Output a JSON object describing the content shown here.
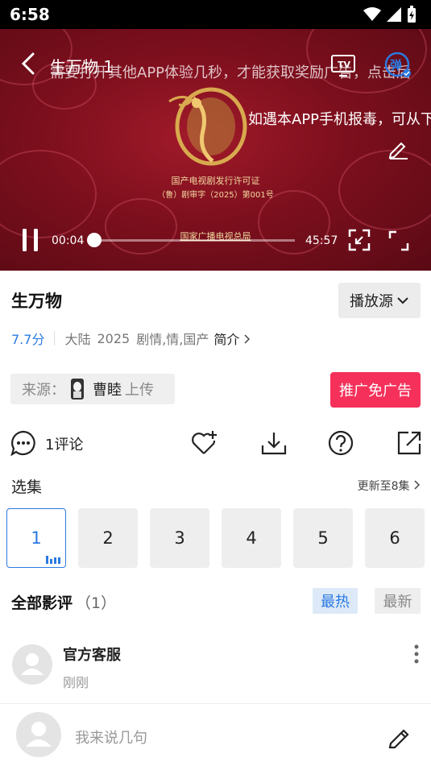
{
  "status_bar": {
    "time": "6:58"
  },
  "player": {
    "title": "生万物 1",
    "marquee_top": "需要打开其他APP体验几秒，才能获取奖励广告，点击后",
    "marquee_mid": "如遇本APP手机报毒，可从下",
    "license_line1": "国产电视剧发行许可证",
    "license_line2": "（鲁）剧审字（2025）第001号",
    "license_line3": "国家广播电视总局",
    "current_time": "00:04",
    "total_time": "45:57",
    "progress": 0.0015
  },
  "show": {
    "title": "生万物",
    "source_button": "播放源",
    "rating": "7.7分",
    "region": "大陆",
    "year": "2025",
    "genres": "剧情,情,国产",
    "intro": "简介"
  },
  "uploader": {
    "prefix": "来源：",
    "name": "曹睦",
    "suffix": "上传",
    "promo_button": "推广免广告"
  },
  "actions": {
    "comment_count": "1评论"
  },
  "episodes": {
    "heading": "选集",
    "update_info": "更新至8集",
    "items": [
      "1",
      "2",
      "3",
      "4",
      "5",
      "6"
    ],
    "active_index": 0
  },
  "reviews": {
    "heading": "全部影评",
    "count": "（1）",
    "sort_hot": "最热",
    "sort_new": "最新",
    "items": [
      {
        "name": "官方客服",
        "time": "刚刚"
      }
    ]
  },
  "composer": {
    "placeholder": "我来说几句"
  },
  "colors": {
    "accent": "#2a7ae2",
    "promo": "#f5305a",
    "player_bg": "#7d0f1d"
  }
}
